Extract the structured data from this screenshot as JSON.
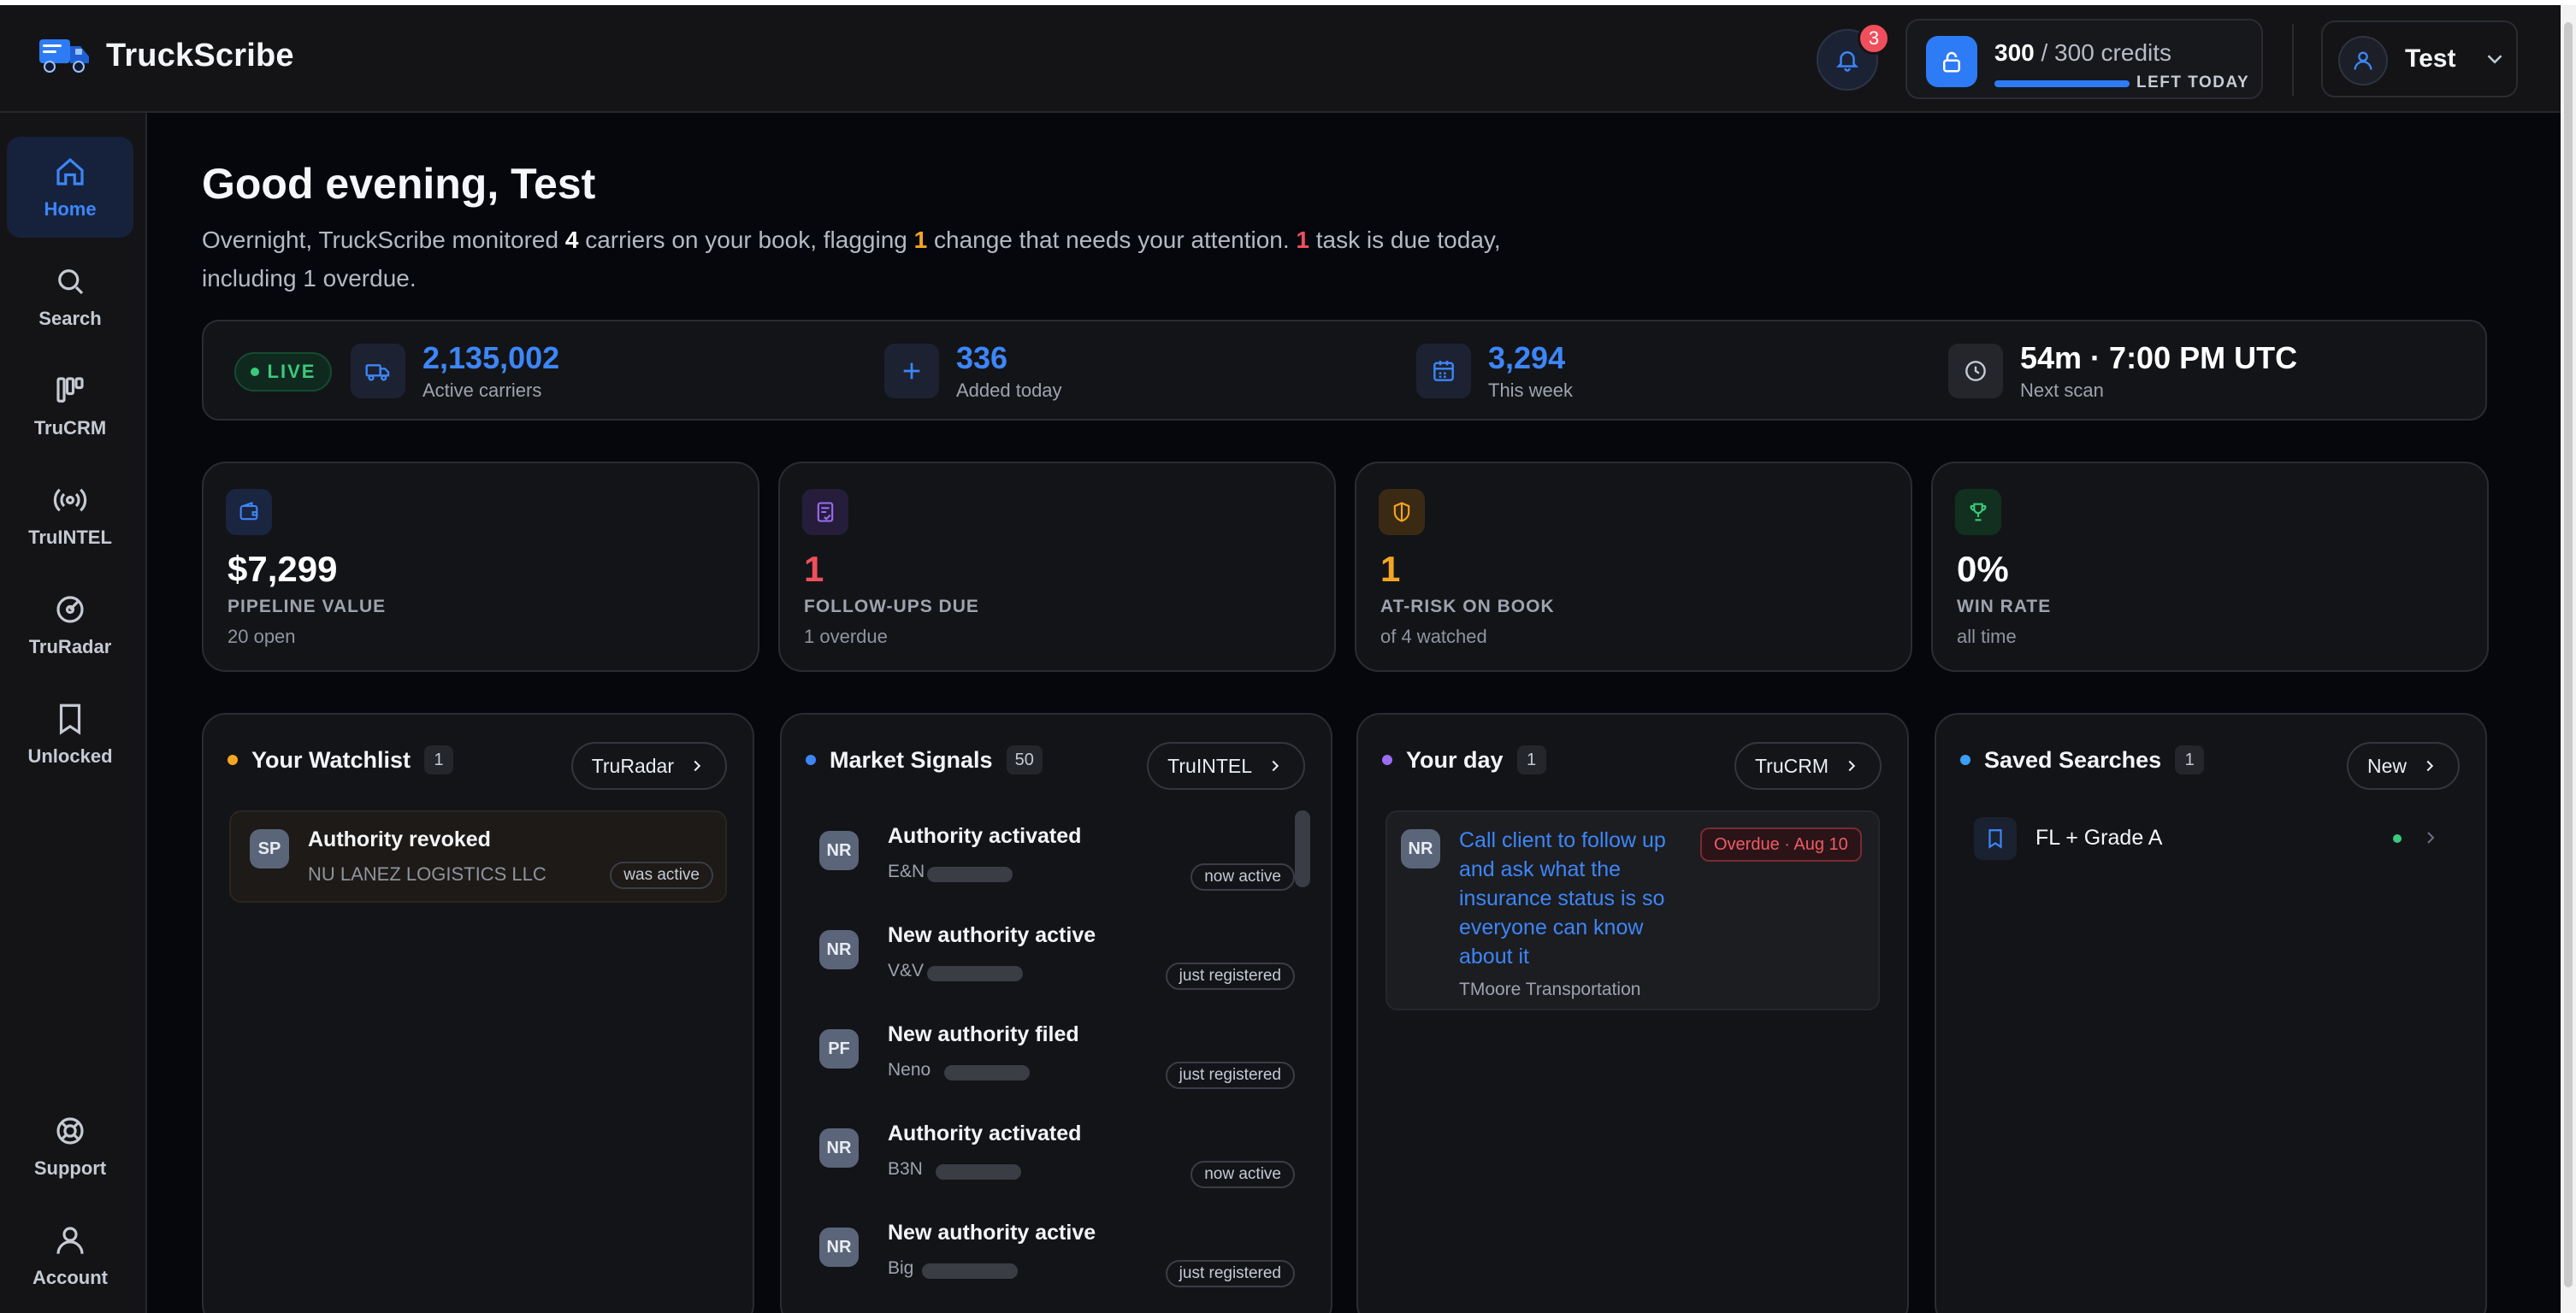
{
  "app": {
    "name": "TruckScribe"
  },
  "colors": {
    "accent": "#3d86f8",
    "orange": "#f5a524",
    "red": "#ef4f5c",
    "green": "#3cc97c",
    "purple": "#9b6cf6"
  },
  "header": {
    "notifications_count": "3",
    "credits": {
      "used": "300",
      "separator": "/ 300 credits",
      "sublabel": "LEFT TODAY",
      "fraction_remaining": 1.0
    },
    "user_name": "Test"
  },
  "sidebar": {
    "items": [
      {
        "label": "Home",
        "icon": "home-icon"
      },
      {
        "label": "Search",
        "icon": "search-icon"
      },
      {
        "label": "TruCRM",
        "icon": "kanban-icon"
      },
      {
        "label": "TruINTEL",
        "icon": "broadcast-icon"
      },
      {
        "label": "TruRadar",
        "icon": "radar-icon"
      },
      {
        "label": "Unlocked",
        "icon": "bookmark-icon"
      }
    ],
    "bottom": [
      {
        "label": "Support",
        "icon": "lifebuoy-icon"
      },
      {
        "label": "Account",
        "icon": "user-icon"
      }
    ]
  },
  "greeting": "Good evening, Test",
  "summary": {
    "p1": "Overnight, TruckScribe monitored ",
    "carriers": "4",
    "p2": " carriers on your book, flagging ",
    "changes": "1",
    "p3": " change that needs your attention. ",
    "tasks": "1",
    "p4": " task is due today,",
    "p5": "including 1 overdue."
  },
  "stats": {
    "live_label": "LIVE",
    "items": [
      {
        "value": "2,135,002",
        "label": "Active carriers"
      },
      {
        "value": "336",
        "label": "Added today"
      },
      {
        "value": "3,294",
        "label": "This week"
      },
      {
        "value": "54m · 7:00 PM UTC",
        "label": "Next scan"
      }
    ]
  },
  "kpis": [
    {
      "value": "$7,299",
      "label": "PIPELINE VALUE",
      "sub": "20 open"
    },
    {
      "value": "1",
      "label": "FOLLOW-UPS DUE",
      "sub": "1 overdue"
    },
    {
      "value": "1",
      "label": "AT-RISK ON BOOK",
      "sub": "of 4 watched"
    },
    {
      "value": "0%",
      "label": "WIN RATE",
      "sub": "all time"
    }
  ],
  "watchlist": {
    "title": "Your Watchlist",
    "count": "1",
    "button": "TruRadar",
    "items": [
      {
        "initials": "SP",
        "title": "Authority revoked",
        "company": "NU LANEZ LOGISTICS LLC",
        "status": "was active"
      }
    ]
  },
  "signals": {
    "title": "Market Signals",
    "count": "50",
    "button": "TruINTEL",
    "items": [
      {
        "initials": "NR",
        "title": "Authority activated",
        "name": "E&N",
        "status": "now active"
      },
      {
        "initials": "NR",
        "title": "New authority active",
        "name": "V&V",
        "status": "just registered"
      },
      {
        "initials": "PF",
        "title": "New authority filed",
        "name": "Neno",
        "status": "just registered"
      },
      {
        "initials": "NR",
        "title": "Authority activated",
        "name": "B3N",
        "status": "now active"
      },
      {
        "initials": "NR",
        "title": "New authority active",
        "name": "Big",
        "status": "just registered"
      }
    ]
  },
  "day": {
    "title": "Your day",
    "count": "1",
    "button": "TruCRM",
    "task": {
      "initials": "NR",
      "text": "Call client to follow up and ask what the insurance status is so everyone can know about it",
      "badge": "Overdue · Aug 10",
      "company": "TMoore Transportation"
    }
  },
  "saved": {
    "title": "Saved Searches",
    "count": "1",
    "button": "New",
    "items": [
      {
        "label": "FL + Grade A"
      }
    ]
  }
}
